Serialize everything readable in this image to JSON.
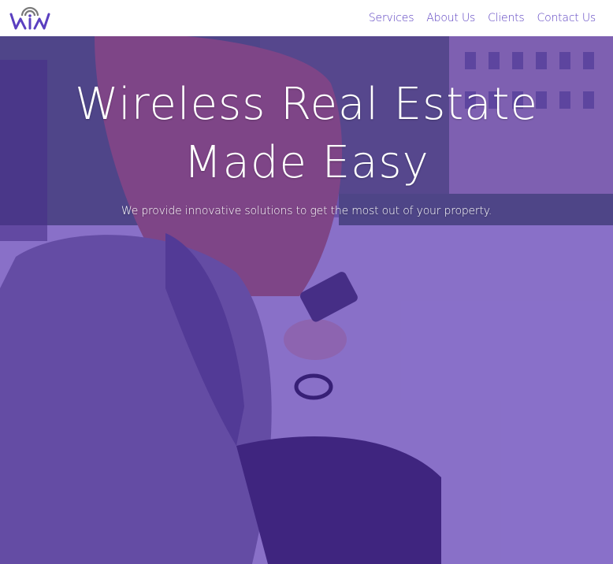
{
  "brand": {
    "logo_icon": "wiw-logo-icon",
    "logo_text": "WiW",
    "accent_color": "#5a3fc0"
  },
  "nav": {
    "items": [
      {
        "label": "Services"
      },
      {
        "label": "About Us"
      },
      {
        "label": "Clients"
      },
      {
        "label": "Contact Us"
      }
    ]
  },
  "hero": {
    "title": "Wireless Real Estate Made Easy",
    "subtitle": "We provide innovative solutions to get the most out of your property.",
    "background_image": "woman-using-phone-on-street-photo",
    "overlay_color": "#5026be"
  }
}
